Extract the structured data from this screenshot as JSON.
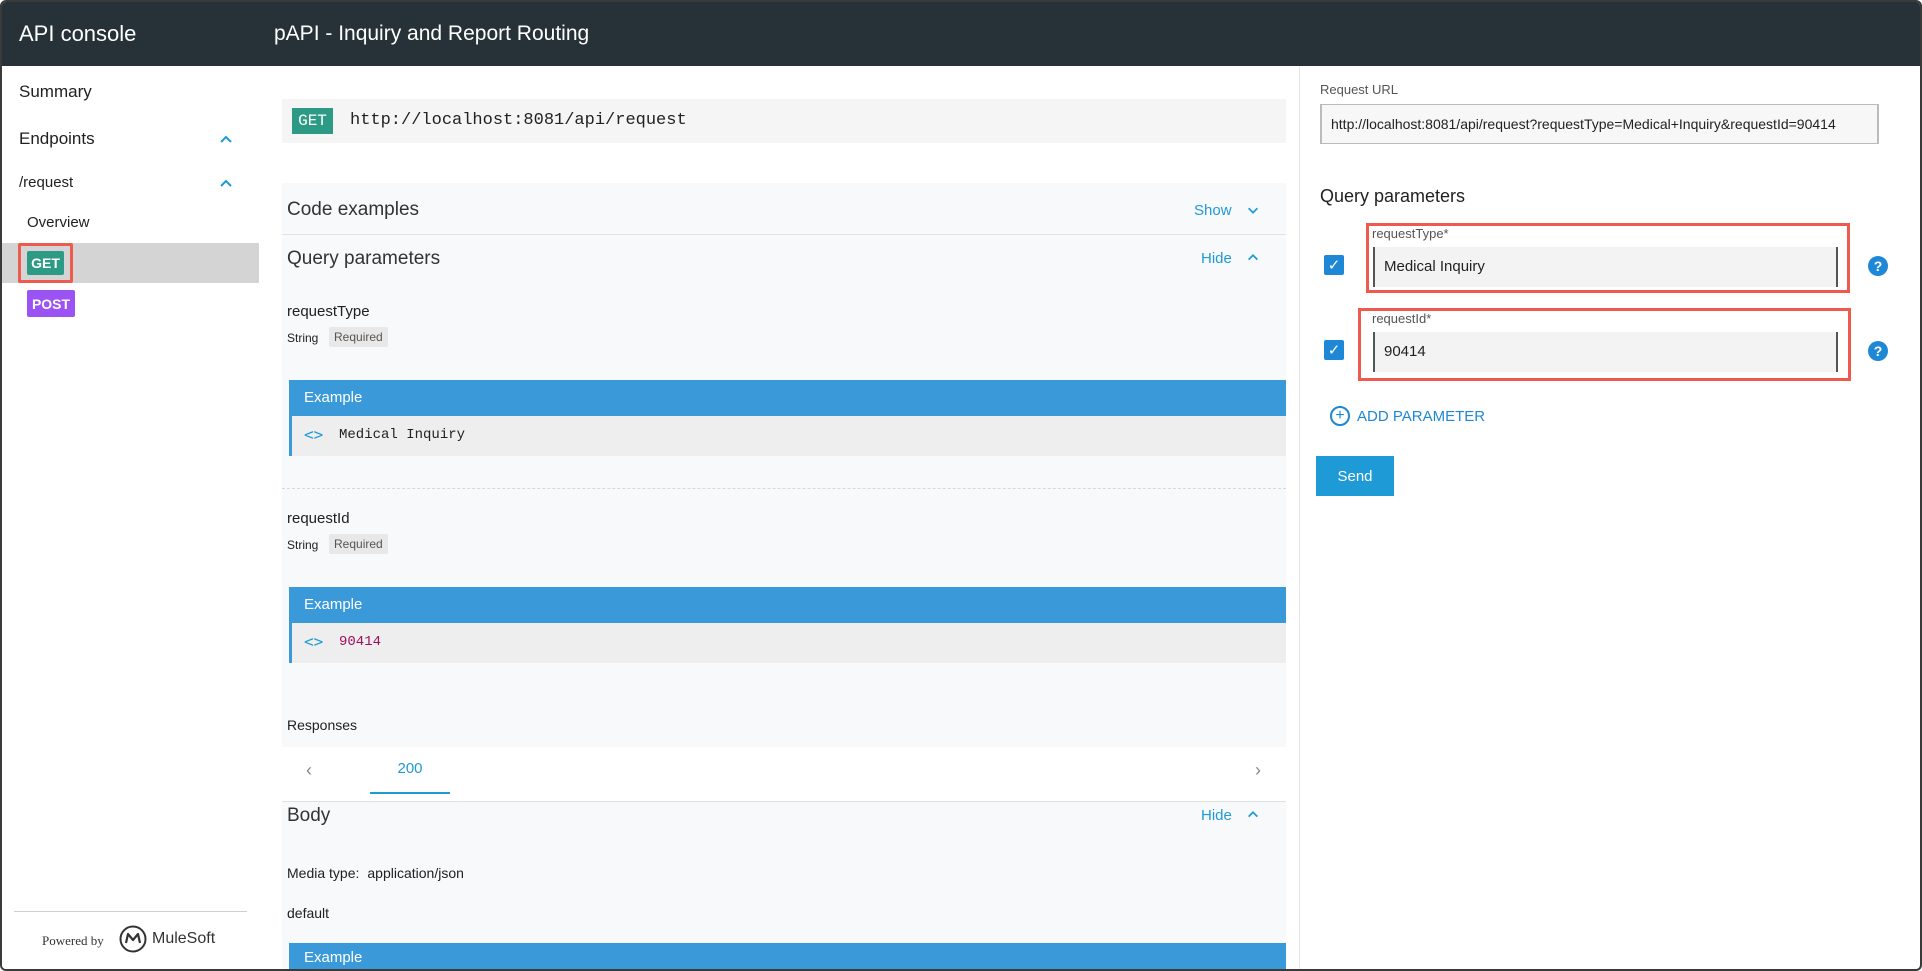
{
  "header": {
    "app_title": "API console",
    "api_title": "pAPI - Inquiry and Report Routing",
    "background": "#263238"
  },
  "sidebar": {
    "summary": "Summary",
    "endpoints": "Endpoints",
    "request_path": "/request",
    "overview": "Overview",
    "get_label": "GET",
    "post_label": "POST",
    "powered_by": "Powered by",
    "brand": "MuleSoft"
  },
  "main": {
    "method": "GET",
    "url": "http://localhost:8081/api/request",
    "code_examples": {
      "title": "Code examples",
      "toggle": "Show"
    },
    "query_params": {
      "title": "Query parameters",
      "toggle": "Hide",
      "params": [
        {
          "name": "requestType",
          "type": "String",
          "required": "Required",
          "example_label": "Example",
          "example_value": "Medical Inquiry"
        },
        {
          "name": "requestId",
          "type": "String",
          "required": "Required",
          "example_label": "Example",
          "example_value": "90414"
        }
      ]
    },
    "responses": {
      "label": "Responses",
      "tab": "200"
    },
    "body": {
      "title": "Body",
      "toggle": "Hide",
      "media_label": "Media type:",
      "media_value": "application/json",
      "default_label": "default",
      "example_label": "Example"
    }
  },
  "right_panel": {
    "request_url_label": "Request URL",
    "request_url": "http://localhost:8081/api/request?requestType=Medical+Inquiry&requestId=90414",
    "qp_title": "Query parameters",
    "fields": [
      {
        "label": "requestType*",
        "value": "Medical Inquiry"
      },
      {
        "label": "requestId*",
        "value": "90414"
      }
    ],
    "add_parameter": "ADD PARAMETER",
    "send": "Send"
  },
  "icons": {
    "chevron_up": "chevron-up-icon",
    "chevron_down": "chevron-down-icon",
    "code": "code-icon",
    "check": "check-icon",
    "help": "help-icon",
    "add": "add-circle-icon"
  },
  "colors": {
    "accent": "#1e9ad6",
    "get": "#2d9a86",
    "post": "#9b53f3",
    "highlight": "#ee5a4e",
    "example_header": "#3a9ad9"
  }
}
